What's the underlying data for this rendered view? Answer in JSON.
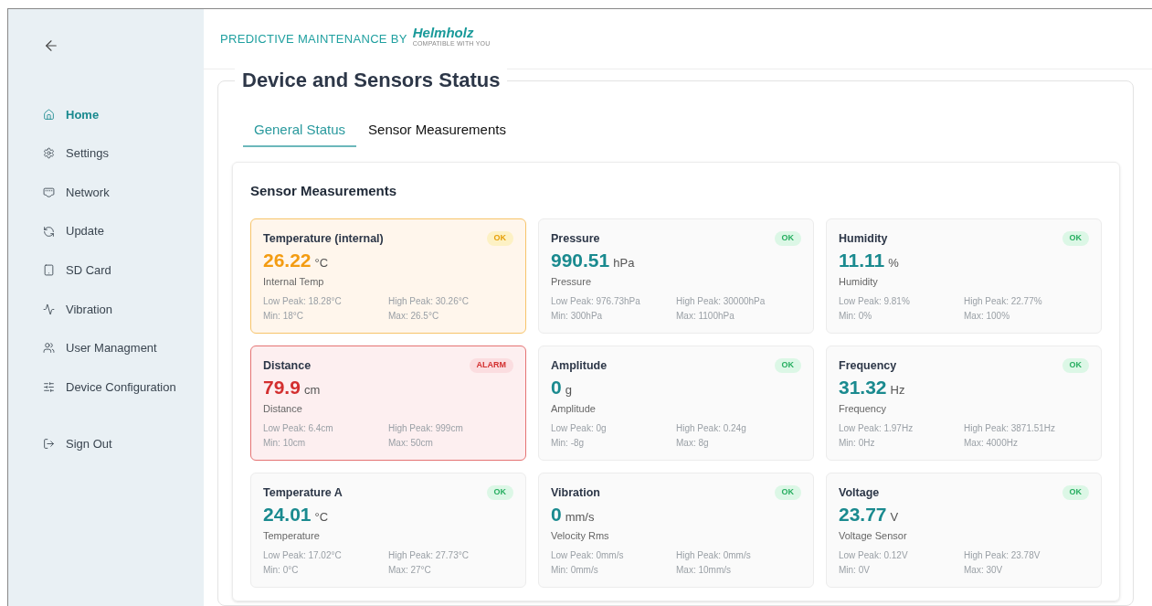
{
  "sidebar": {
    "items": [
      {
        "label": "Home",
        "selected": true
      },
      {
        "label": "Settings",
        "selected": false
      },
      {
        "label": "Network",
        "selected": false
      },
      {
        "label": "Update",
        "selected": false
      },
      {
        "label": "SD Card",
        "selected": false
      },
      {
        "label": "Vibration",
        "selected": false
      },
      {
        "label": "User Managment",
        "selected": false
      },
      {
        "label": "Device Configuration",
        "selected": false
      }
    ],
    "sign_out": {
      "label": "Sign Out"
    }
  },
  "header": {
    "title": "PREDICTIVE MAINTENANCE BY",
    "logo": "Helmholz",
    "logo_tagline": "COMPATIBLE WITH YOU"
  },
  "panel": {
    "title": "Device and Sensors Status",
    "tabs": [
      {
        "label": "General Status",
        "selected": true
      },
      {
        "label": "Sensor Measurements",
        "selected": false
      }
    ],
    "section_title": "Sensor Measurements",
    "sensors": [
      {
        "name": "Temperature (internal)",
        "kind": "warning",
        "badge": "OK",
        "value": "26.22",
        "unit": "°C",
        "description": "Internal Temp",
        "low_peak": "Low Peak: 18.28°C",
        "high_peak": "High Peak: 30.26°C",
        "min": "Min: 18°C",
        "max": "Max: 26.5°C"
      },
      {
        "name": "Pressure",
        "kind": "ok",
        "badge": "OK",
        "value": "990.51",
        "unit": "hPa",
        "description": "Pressure",
        "low_peak": "Low Peak: 976.73hPa",
        "high_peak": "High Peak: 30000hPa",
        "min": "Min: 300hPa",
        "max": "Max: 1100hPa"
      },
      {
        "name": "Humidity",
        "kind": "ok",
        "badge": "OK",
        "value": "11.11",
        "unit": "%",
        "description": "Humidity",
        "low_peak": "Low Peak: 9.81%",
        "high_peak": "High Peak: 22.77%",
        "min": "Min: 0%",
        "max": "Max: 100%"
      },
      {
        "name": "Distance",
        "kind": "alarm",
        "badge": "ALARM",
        "value": "79.9",
        "unit": "cm",
        "description": "Distance",
        "low_peak": "Low Peak: 6.4cm",
        "high_peak": "High Peak: 999cm",
        "min": "Min: 10cm",
        "max": "Max: 50cm"
      },
      {
        "name": "Amplitude",
        "kind": "ok",
        "badge": "OK",
        "value": "0",
        "unit": "g",
        "description": "Amplitude",
        "low_peak": "Low Peak: 0g",
        "high_peak": "High Peak: 0.24g",
        "min": "Min: -8g",
        "max": "Max: 8g"
      },
      {
        "name": "Frequency",
        "kind": "ok",
        "badge": "OK",
        "value": "31.32",
        "unit": "Hz",
        "description": "Frequency",
        "low_peak": "Low Peak: 1.97Hz",
        "high_peak": "High Peak: 3871.51Hz",
        "min": "Min: 0Hz",
        "max": "Max: 4000Hz"
      },
      {
        "name": "Temperature A",
        "kind": "ok",
        "badge": "OK",
        "value": "24.01",
        "unit": "°C",
        "description": "Temperature",
        "low_peak": "Low Peak: 17.02°C",
        "high_peak": "High Peak: 27.73°C",
        "min": "Min: 0°C",
        "max": "Max: 27°C"
      },
      {
        "name": "Vibration",
        "kind": "ok",
        "badge": "OK",
        "value": "0",
        "unit": "mm/s",
        "description": "Velocity Rms",
        "low_peak": "Low Peak: 0mm/s",
        "high_peak": "High Peak: 0mm/s",
        "min": "Min: 0mm/s",
        "max": "Max: 10mm/s"
      },
      {
        "name": "Voltage",
        "kind": "ok",
        "badge": "OK",
        "value": "23.77",
        "unit": "V",
        "description": "Voltage Sensor",
        "low_peak": "Low Peak: 0.12V",
        "high_peak": "High Peak: 23.78V",
        "min": "Min: 0V",
        "max": "Max: 30V"
      }
    ]
  }
}
